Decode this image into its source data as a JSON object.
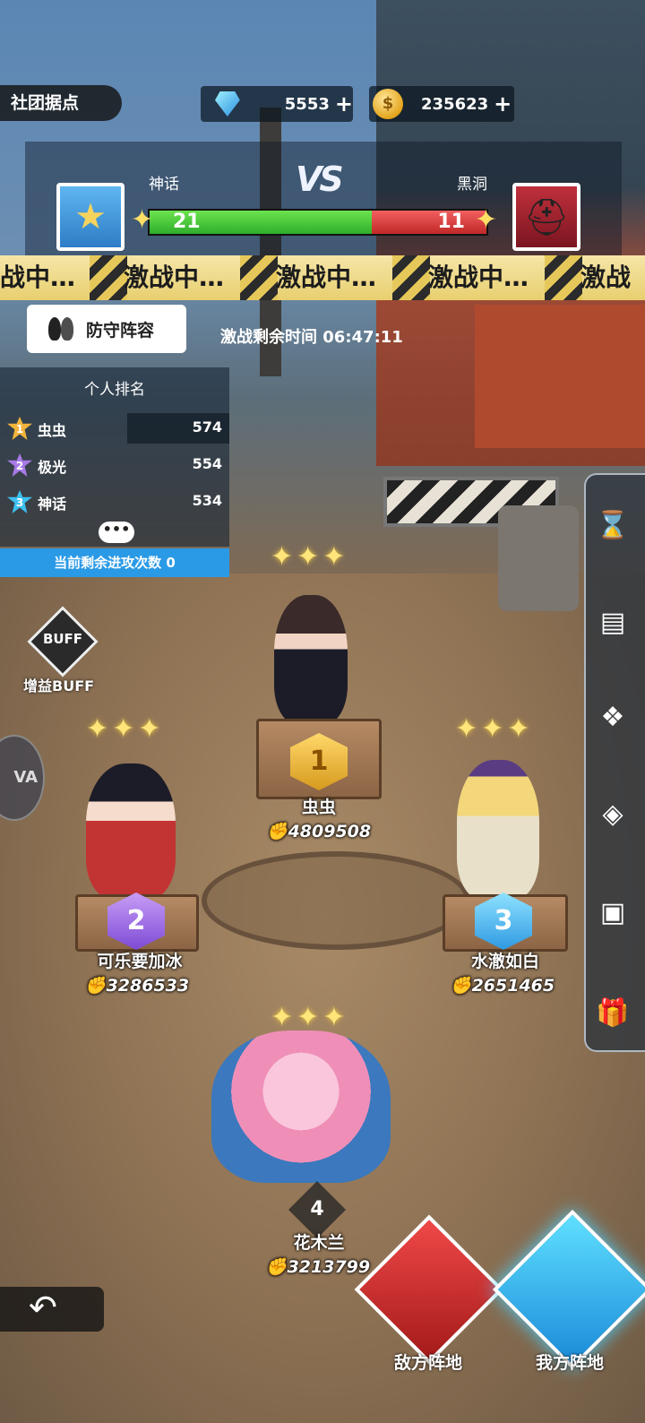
{
  "header": {
    "title": "社团据点",
    "gems": "5553",
    "coins": "235623",
    "plus_symbol": "+"
  },
  "versus": {
    "left_team": "神话",
    "right_team": "黑洞",
    "vs_label": "VS",
    "left_score": "21",
    "right_score": "11",
    "left_fraction": 0.66
  },
  "banner": {
    "items": [
      "战中…",
      "激战中…",
      "激战中…",
      "激战中…",
      "激战"
    ]
  },
  "defense_button": "防守阵容",
  "timer": {
    "label": "激战剩余时间",
    "value": "06:47:11"
  },
  "ranking": {
    "title": "个人排名",
    "rows": [
      {
        "rank": "1",
        "name": "虫虫",
        "score": "574"
      },
      {
        "rank": "2",
        "name": "极光",
        "score": "554"
      },
      {
        "rank": "3",
        "name": "神话",
        "score": "534"
      }
    ],
    "more": "•••",
    "attacks_left": "当前剩余进攻次数 0"
  },
  "buff": {
    "icon_text": "BUFF",
    "label": "增益BUFF"
  },
  "left_avatar_text": "VA",
  "heroes": [
    {
      "rank": "1",
      "name": "虫虫",
      "power": "4809508"
    },
    {
      "rank": "2",
      "name": "可乐要加冰",
      "power": "3286533"
    },
    {
      "rank": "3",
      "name": "水澈如白",
      "power": "2651465"
    },
    {
      "rank": "4",
      "name": "花木兰",
      "power": "3213799"
    }
  ],
  "power_icon": "fist-icon",
  "bottom": {
    "enemy_base": "敌方阵地",
    "my_base": "我方阵地"
  },
  "colors": {
    "green_bar": "#3fc23a",
    "red_bar": "#d83434",
    "accent_blue": "#2b9ae6"
  }
}
